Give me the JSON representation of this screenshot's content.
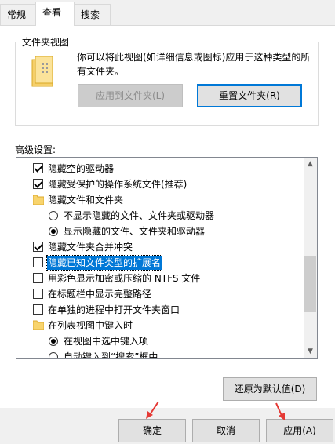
{
  "tabs": [
    {
      "label": "常规"
    },
    {
      "label": "查看"
    },
    {
      "label": "搜索"
    }
  ],
  "folder_view": {
    "title": "文件夹视图",
    "description": "你可以将此视图(如详细信息或图标)应用于这种类型的所有文件夹。",
    "apply_button": "应用到文件夹(L)",
    "reset_button": "重置文件夹(R)"
  },
  "advanced": {
    "label": "高级设置:",
    "items": [
      {
        "type": "checkbox",
        "checked": true,
        "label": "隐藏空的驱动器"
      },
      {
        "type": "checkbox",
        "checked": true,
        "label": "隐藏受保护的操作系统文件(推荐)"
      },
      {
        "type": "folder",
        "label": "隐藏文件和文件夹"
      },
      {
        "type": "radio",
        "checked": false,
        "label": "不显示隐藏的文件、文件夹或驱动器"
      },
      {
        "type": "radio",
        "checked": true,
        "label": "显示隐藏的文件、文件夹和驱动器"
      },
      {
        "type": "checkbox",
        "checked": true,
        "label": "隐藏文件夹合并冲突"
      },
      {
        "type": "checkbox",
        "checked": false,
        "label": "隐藏已知文件类型的扩展名",
        "selected": true
      },
      {
        "type": "checkbox",
        "checked": false,
        "label": "用彩色显示加密或压缩的 NTFS 文件"
      },
      {
        "type": "checkbox",
        "checked": false,
        "label": "在标题栏中显示完整路径"
      },
      {
        "type": "checkbox",
        "checked": false,
        "label": "在单独的进程中打开文件夹窗口"
      },
      {
        "type": "folder",
        "label": "在列表视图中键入时"
      },
      {
        "type": "radio",
        "checked": true,
        "label": "在视图中选中键入项"
      },
      {
        "type": "radio",
        "checked": false,
        "label": "自动键入到“搜索”框中"
      }
    ]
  },
  "buttons": {
    "restore": "还原为默认值(D)",
    "ok": "确定",
    "cancel": "取消",
    "apply": "应用(A)"
  },
  "colors": {
    "accent": "#0078d7",
    "annotation_arrow": "#e53935"
  },
  "icons": {
    "folder": "folder-icon",
    "scroll_up": "scroll-up-arrow-icon",
    "scroll_down": "scroll-down-arrow-icon"
  }
}
